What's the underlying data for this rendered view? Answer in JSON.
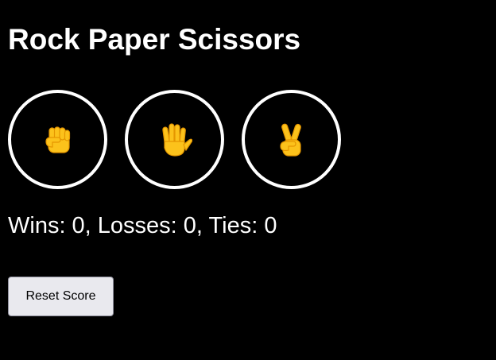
{
  "title": "Rock Paper Scissors",
  "moves": [
    {
      "name": "rock",
      "icon": "raised-fist-icon"
    },
    {
      "name": "paper",
      "icon": "raised-hand-icon"
    },
    {
      "name": "scissors",
      "icon": "victory-hand-icon"
    }
  ],
  "score": {
    "wins": 0,
    "losses": 0,
    "ties": 0,
    "text": "Wins: 0, Losses: 0, Ties: 0"
  },
  "reset_label": "Reset Score",
  "colors": {
    "background": "#000000",
    "text": "#ffffff",
    "ring": "#ffffff",
    "emoji_fill": "#fcc21b",
    "emoji_stroke": "#e59600",
    "button_bg": "#e9e9ee"
  }
}
